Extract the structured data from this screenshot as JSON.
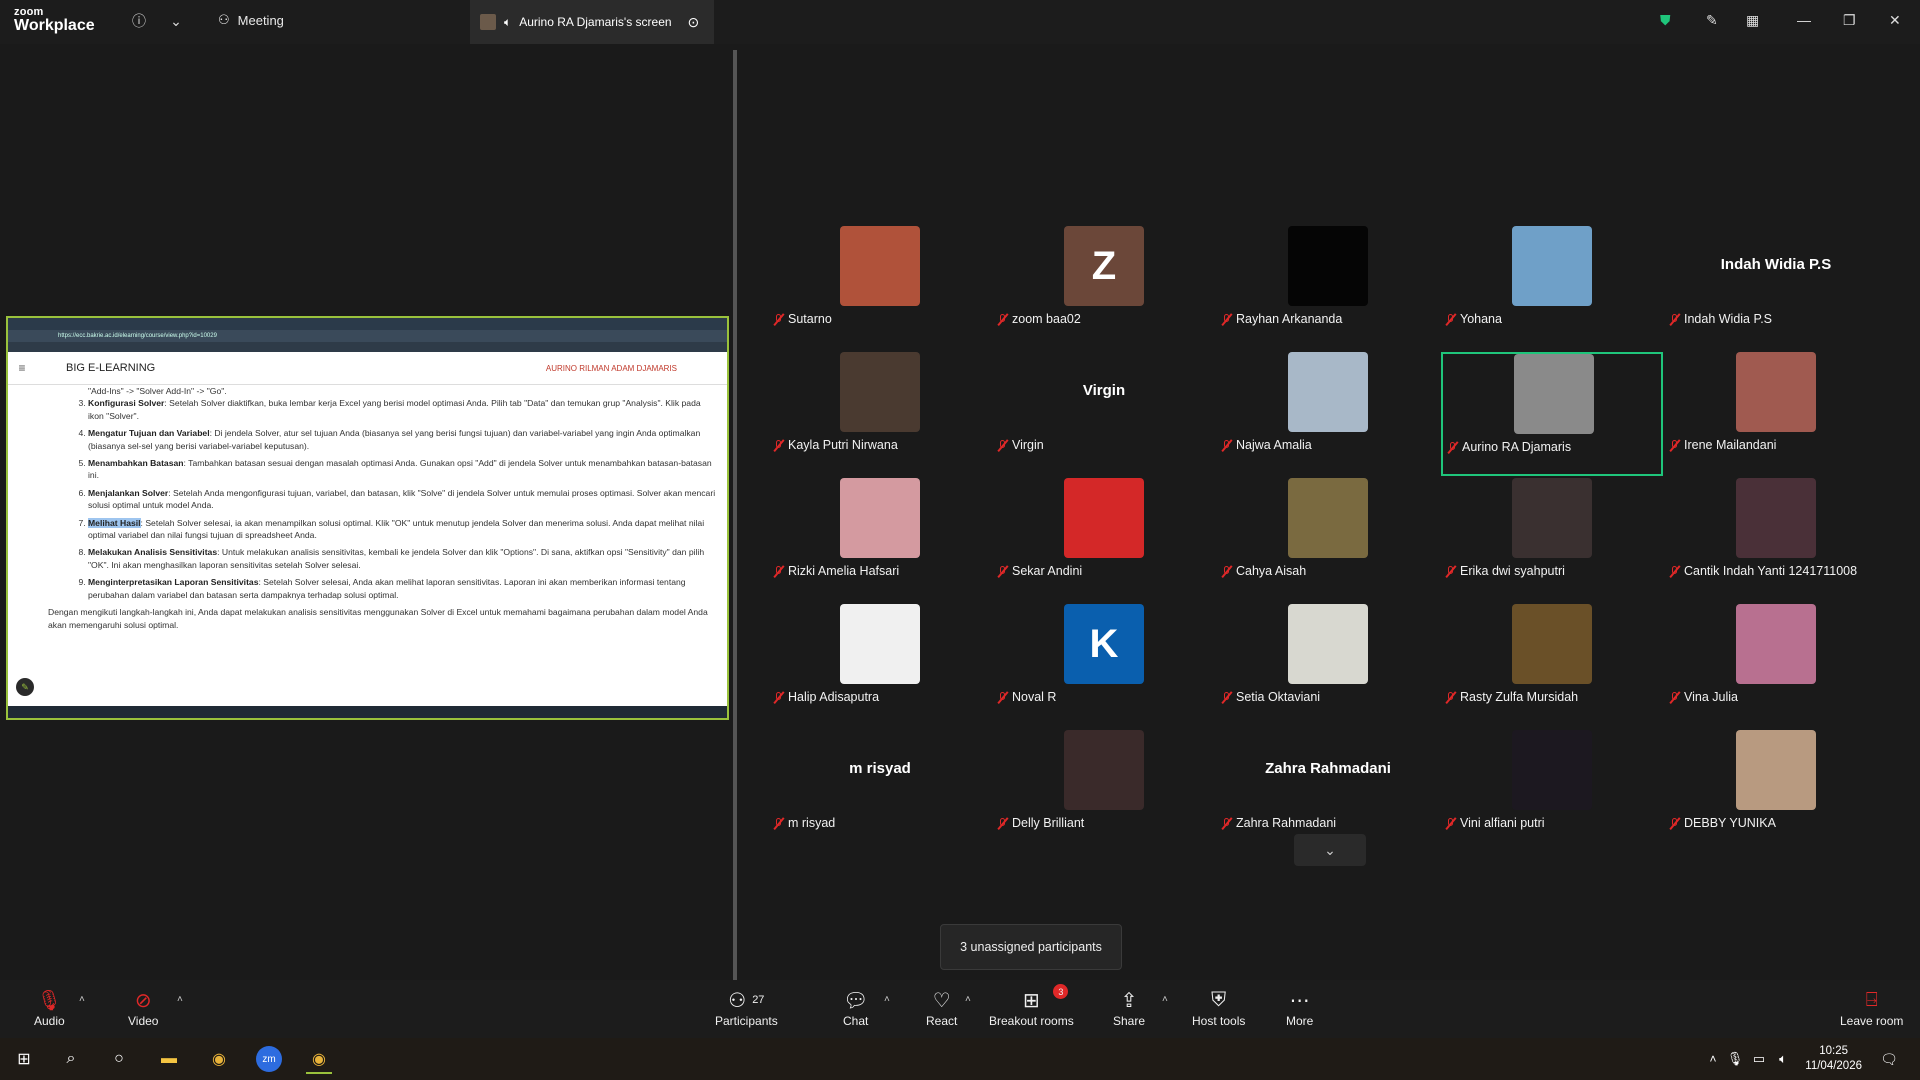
{
  "app": {
    "logo_line1": "zoom",
    "logo_line2": "Workplace",
    "meeting_label": "Meeting",
    "share_tab_label": "Aurino RA Djamaris's screen"
  },
  "colors": {
    "active_speaker": "#1fc57b",
    "share_border": "#9ac23c",
    "muted": "#e02828",
    "background": "#1a1a1a"
  },
  "shared_screen": {
    "url": "https://ecc.bakrie.ac.id/elearning/course/view.php?id=10029",
    "site_title": "BIG E-LEARNING",
    "user": "AURINO RILMAN ADAM DJAMARIS",
    "top_fragment": "\"Add-Ins\" -> \"Solver Add-In\" -> \"Go\".",
    "steps": [
      {
        "title": "Konfigurasi Solver",
        "text": ": Setelah Solver diaktifkan, buka lembar kerja Excel yang berisi model optimasi Anda. Pilih tab \"Data\" dan temukan grup \"Analysis\". Klik pada ikon \"Solver\"."
      },
      {
        "title": "Mengatur Tujuan dan Variabel",
        "text": ": Di jendela Solver, atur sel tujuan Anda (biasanya sel yang berisi fungsi tujuan) dan variabel-variabel yang ingin Anda optimalkan (biasanya sel-sel yang berisi variabel-variabel keputusan)."
      },
      {
        "title": "Menambahkan Batasan",
        "text": ": Tambahkan batasan sesuai dengan masalah optimasi Anda. Gunakan opsi \"Add\" di jendela Solver untuk menambahkan batasan-batasan ini."
      },
      {
        "title": "Menjalankan Solver",
        "text": ": Setelah Anda mengonfigurasi tujuan, variabel, dan batasan, klik \"Solve\" di jendela Solver untuk memulai proses optimasi. Solver akan mencari solusi optimal untuk model Anda."
      },
      {
        "title": "Melihat Hasil",
        "text": ": Setelah Solver selesai, ia akan menampilkan solusi optimal. Klik \"OK\" untuk menutup jendela Solver dan menerima solusi. Anda dapat melihat nilai optimal variabel dan nilai fungsi tujuan di spreadsheet Anda."
      },
      {
        "title": "Melakukan Analisis Sensitivitas",
        "text": ": Untuk melakukan analisis sensitivitas, kembali ke jendela Solver dan klik \"Options\". Di sana, aktifkan opsi \"Sensitivity\" dan pilih \"OK\". Ini akan menghasilkan laporan sensitivitas setelah Solver selesai."
      },
      {
        "title": "Menginterpretasikan Laporan Sensitivitas",
        "text": ": Setelah Solver selesai, Anda akan melihat laporan sensitivitas. Laporan ini akan memberikan informasi tentang perubahan dalam variabel dan batasan serta dampaknya terhadap solusi optimal."
      }
    ],
    "closing": "Dengan mengikuti langkah-langkah ini, Anda dapat melakukan analisis sensitivitas menggunakan Solver di Excel untuk memahami bagaimana perubahan dalam model Anda akan memengaruhi solusi optimal."
  },
  "participants": [
    {
      "name": "Sutarno",
      "type": "photo",
      "color": "#b0523a"
    },
    {
      "name": "zoom baa02",
      "type": "letter",
      "letter": "Z",
      "color": "#6b4739"
    },
    {
      "name": "Rayhan Arkananda",
      "type": "photo",
      "color": "#050505"
    },
    {
      "name": "Yohana",
      "type": "photo",
      "color": "#6fa0c8"
    },
    {
      "name": "Indah Widia P.S",
      "type": "text",
      "big": "Indah Widia P.S"
    },
    {
      "name": "Kayla Putri Nirwana",
      "type": "photo",
      "color": "#4a3a30"
    },
    {
      "name": "Virgin",
      "type": "text",
      "big": "Virgin"
    },
    {
      "name": "Najwa Amalia",
      "type": "photo",
      "color": "#a8b8c8"
    },
    {
      "name": "Aurino RA Djamaris",
      "type": "photo",
      "color": "#8a8a8a"
    },
    {
      "name": "Irene Mailandani",
      "type": "photo",
      "color": "#a05a50"
    },
    {
      "name": "Rizki Amelia Hafsari",
      "type": "photo",
      "color": "#d49aa0"
    },
    {
      "name": "Sekar Andini",
      "type": "photo",
      "color": "#d42828"
    },
    {
      "name": "Cahya Aisah",
      "type": "photo",
      "color": "#7a6a40"
    },
    {
      "name": "Erika dwi syahputri",
      "type": "photo",
      "color": "#3a3030"
    },
    {
      "name": "Cantik Indah Yanti 1241711008",
      "type": "photo",
      "color": "#4a3038"
    },
    {
      "name": "Halip Adisaputra",
      "type": "photo",
      "color": "#f0f0f0"
    },
    {
      "name": "Noval R",
      "type": "letter",
      "letter": "K",
      "color": "#0a5fae"
    },
    {
      "name": "Setia Oktaviani",
      "type": "photo",
      "color": "#d8d8d0"
    },
    {
      "name": "Rasty Zulfa Mursidah",
      "type": "photo",
      "color": "#6a5028"
    },
    {
      "name": "Vina Julia",
      "type": "photo",
      "color": "#b87090"
    },
    {
      "name": "m risyad",
      "type": "text",
      "big": "m risyad"
    },
    {
      "name": "Delly Brilliant",
      "type": "photo",
      "color": "#3a2a2a"
    },
    {
      "name": "Zahra Rahmadani",
      "type": "text",
      "big": "Zahra Rahmadani"
    },
    {
      "name": "Vini alfiani putri",
      "type": "photo",
      "color": "#1c1820"
    },
    {
      "name": "DEBBY YUNIKA",
      "type": "photo",
      "color": "#b89a80"
    }
  ],
  "unassigned": "3 unassigned participants",
  "toolbar": {
    "audio": "Audio",
    "video": "Video",
    "participants": "Participants",
    "participants_count": "27",
    "chat": "Chat",
    "react": "React",
    "breakout": "Breakout rooms",
    "breakout_badge": "3",
    "share": "Share",
    "host_tools": "Host tools",
    "more": "More",
    "leave": "Leave room"
  },
  "taskbar": {
    "time": "10:25",
    "date": "11/04/2026"
  }
}
